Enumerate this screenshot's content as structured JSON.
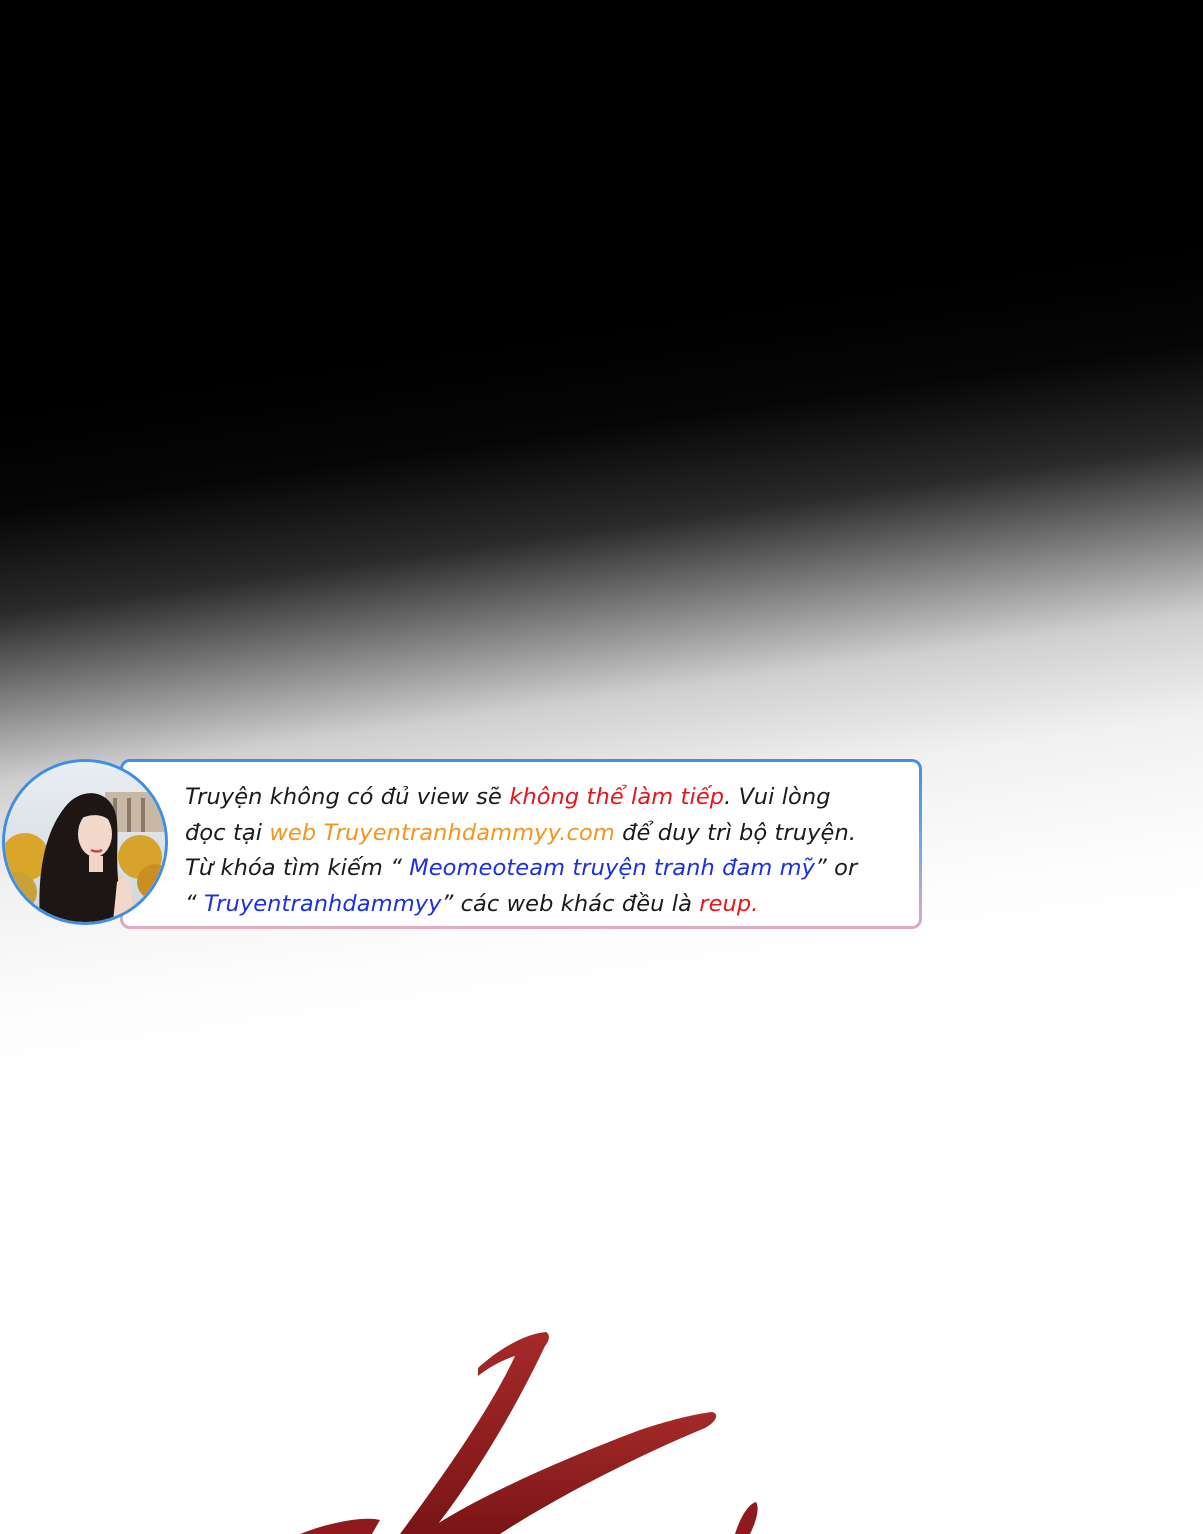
{
  "notice": {
    "line1_a": "Truyện không có đủ view sẽ ",
    "line1_b": "không thể làm tiếp",
    "line1_c": ". Vui lòng",
    "line2_a": "đọc tại ",
    "line2_b": "web Truyentranhdammyy.com",
    "line2_c": " để duy trì bộ truyện.",
    "line3_a": "Từ khóa tìm kiếm “ ",
    "line3_b": "Meomeoteam truyện tranh đam mỹ",
    "line3_c": "” or",
    "line4_a": "“ ",
    "line4_b": "Truyentranhdammyy",
    "line4_c": "” các web khác đều là ",
    "line4_d": "reup."
  },
  "colors": {
    "highlight_red": "#e8141b",
    "highlight_orange": "#f7941d",
    "highlight_blue": "#1b2fe6",
    "box_border": "#3f8ee6",
    "brush_stroke": "#8e1a1d"
  },
  "icons": {
    "avatar": "woman-portrait-photo",
    "artwork": "red-brush-stroke"
  }
}
